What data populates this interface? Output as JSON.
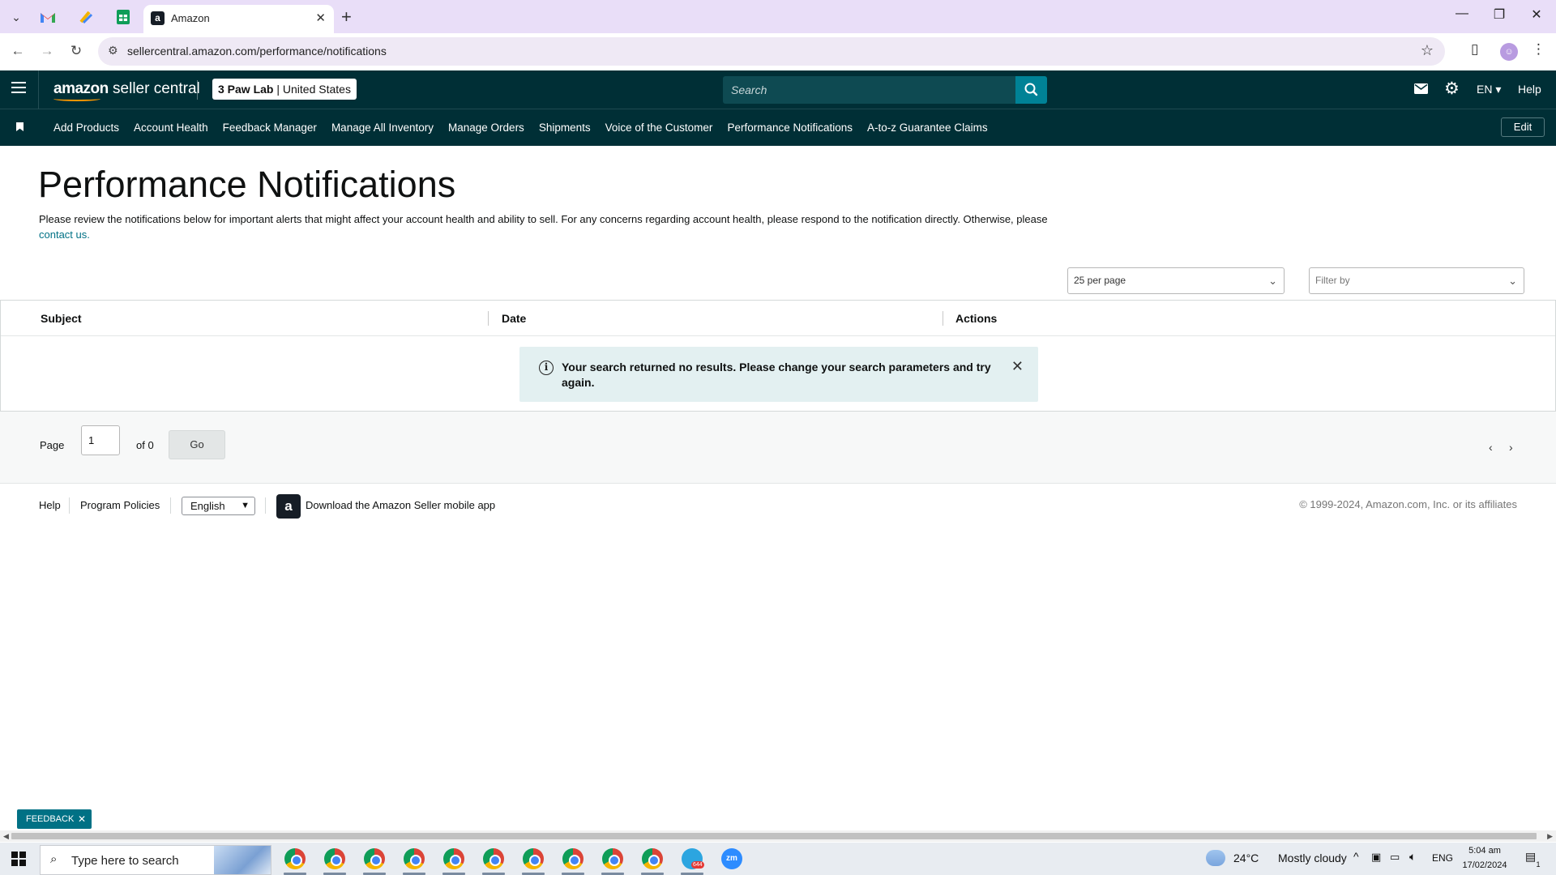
{
  "browser": {
    "active_tab_title": "Amazon",
    "favicon_letter": "a",
    "url": "sellercentral.amazon.com/performance/notifications"
  },
  "header": {
    "logo_primary": "amazon",
    "logo_secondary": "seller central",
    "store_name": "3 Paw Lab",
    "marketplace": "United States",
    "search_placeholder": "Search",
    "language": "EN",
    "help": "Help"
  },
  "nav": {
    "items": [
      "Add Products",
      "Account Health",
      "Feedback Manager",
      "Manage All Inventory",
      "Manage Orders",
      "Shipments",
      "Voice of the Customer",
      "Performance Notifications",
      "A-to-z Guarantee Claims"
    ],
    "edit": "Edit"
  },
  "page": {
    "title": "Performance Notifications",
    "intro_text": "Please review the notifications below for important alerts that might affect your account health and ability to sell. For any concerns regarding account health, please respond to the notification directly. Otherwise, please",
    "intro_link": "contact us.",
    "per_page": "25 per page",
    "filter_placeholder": "Filter by"
  },
  "table": {
    "columns": [
      "Subject",
      "Date",
      "Actions"
    ],
    "empty_message": "Your search returned no results. Please change your search parameters and try again."
  },
  "pager": {
    "page_label": "Page",
    "page_value": "1",
    "of_label": "of 0",
    "go": "Go"
  },
  "footer": {
    "help": "Help",
    "program_policies": "Program Policies",
    "language": "English",
    "app_link": "Download the Amazon Seller mobile app",
    "copyright": "© 1999-2024, Amazon.com, Inc. or its affiliates"
  },
  "feedback": "FEEDBACK",
  "taskbar": {
    "search_placeholder": "Type here to search",
    "weather_temp": "24°C",
    "weather_desc": "Mostly cloudy",
    "input_lang": "ENG",
    "time": "5:04 am",
    "date": "17/02/2024",
    "telegram_badge": "644",
    "notification_count": "1"
  }
}
